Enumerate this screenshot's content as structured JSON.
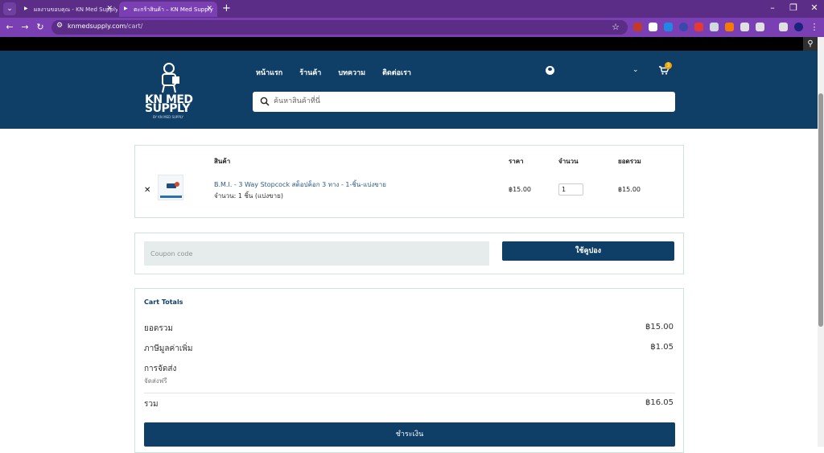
{
  "browser": {
    "tabs": [
      {
        "label": "ผลงานขอบคุณ - KN Med Supply — ..."
      },
      {
        "label": "ตะกร้าสินค้า – KN Med Supply"
      }
    ],
    "url_domain": "knmedsupply.com",
    "url_path": "/cart/"
  },
  "header": {
    "logo_text": "KN MED SUPPLY",
    "logo_sub": "BY KN MED SUPPLY",
    "nav": [
      "หน้าแรก",
      "ร้านค้า",
      "บทความ",
      "ติดต่อเรา"
    ],
    "cart_count": "3",
    "search_placeholder": "ค้นหาสินค้าที่นี่"
  },
  "cart": {
    "columns": {
      "product": "สินค้า",
      "price": "ราคา",
      "qty": "จำนวน",
      "total": "ยอดรวม"
    },
    "items": [
      {
        "name": "B.M.I. - 3 Way Stopcock สต็อปค็อก 3 ทาง - 1-ชิ้น-แบ่งขาย",
        "meta": "จำนวน: 1 ชิ้น (แบ่งขาย)",
        "price": "฿15.00",
        "qty": "1",
        "total": "฿15.00"
      }
    ]
  },
  "coupon": {
    "placeholder": "Coupon code",
    "button": "ใช้คูปอง"
  },
  "totals": {
    "title": "Cart Totals",
    "subtotal_label": "ยอดรวม",
    "subtotal": "฿15.00",
    "vat_label": "ภาษีมูลค่าเพิ่ม",
    "vat": "฿1.05",
    "shipping_label": "การจัดส่ง",
    "shipping_value": "จัดส่งฟรี",
    "total_label": "รวม",
    "total": "฿16.05",
    "checkout": "ชำระเงิน"
  },
  "colors": {
    "brand": "#0f3f67",
    "browser": "#7a3fb3"
  }
}
